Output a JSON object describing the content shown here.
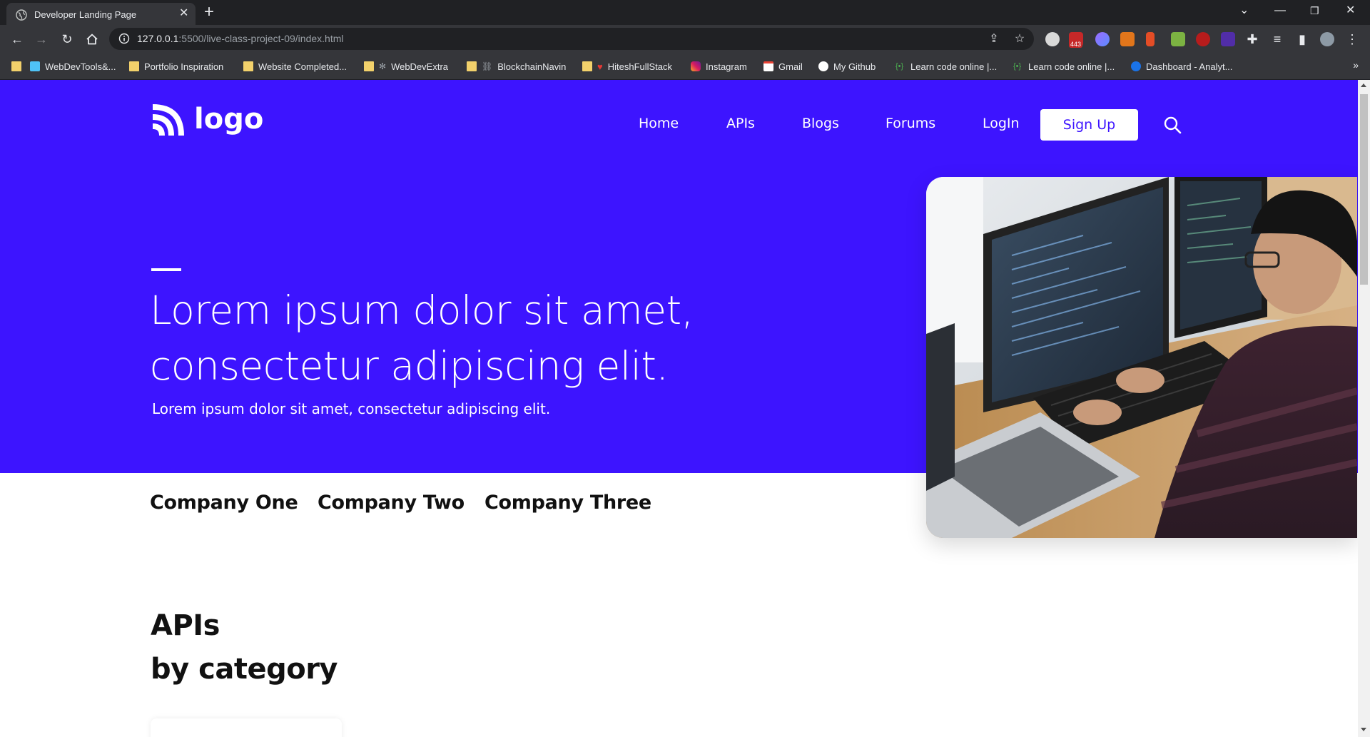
{
  "browser": {
    "tab_title": "Developer Landing Page",
    "url_host": "127.0.0.1",
    "url_path": ":5500/live-class-project-09/index.html",
    "bookmarks": [
      {
        "label": "WebDevTools&...",
        "icon": "bookmark-page-icon"
      },
      {
        "label": "Portfolio Inspiration",
        "icon": "folder-icon"
      },
      {
        "label": "Website Completed...",
        "icon": "folder-icon"
      },
      {
        "label": "WebDevExtra",
        "icon": "folder-icon"
      },
      {
        "label": "BlockchainNavin",
        "icon": "folder-icon"
      },
      {
        "label": "HiteshFullStack",
        "icon": "folder-icon"
      },
      {
        "label": "Instagram",
        "icon": "instagram-icon"
      },
      {
        "label": "Gmail",
        "icon": "gmail-icon"
      },
      {
        "label": "My Github",
        "icon": "github-icon"
      },
      {
        "label": "Learn code online |...",
        "icon": "codestudio-icon"
      },
      {
        "label": "Learn code online |...",
        "icon": "codestudio-icon"
      },
      {
        "label": "Dashboard - Analyt...",
        "icon": "analytics-icon"
      }
    ],
    "more_bookmarks": "»",
    "extension_badge": "443"
  },
  "site": {
    "logo_text": "logo",
    "nav": {
      "home": "Home",
      "apis": "APIs",
      "blogs": "Blogs",
      "forums": "Forums",
      "login": "LogIn",
      "signup": "Sign Up"
    },
    "hero": {
      "headline_line1": "Lorem ipsum dolor sit amet,",
      "headline_line2": "consectetur adipiscing elit.",
      "subtitle": "Lorem ipsum dolor sit amet, consectetur adipiscing elit."
    },
    "companies": [
      "Company One",
      "Company Two",
      "Company Three"
    ],
    "section": {
      "title_line1": "APIs",
      "title_line2": "by category"
    }
  },
  "colors": {
    "brand": "#3d14ff",
    "text_dark": "#111111",
    "chrome_bg": "#35363a"
  }
}
